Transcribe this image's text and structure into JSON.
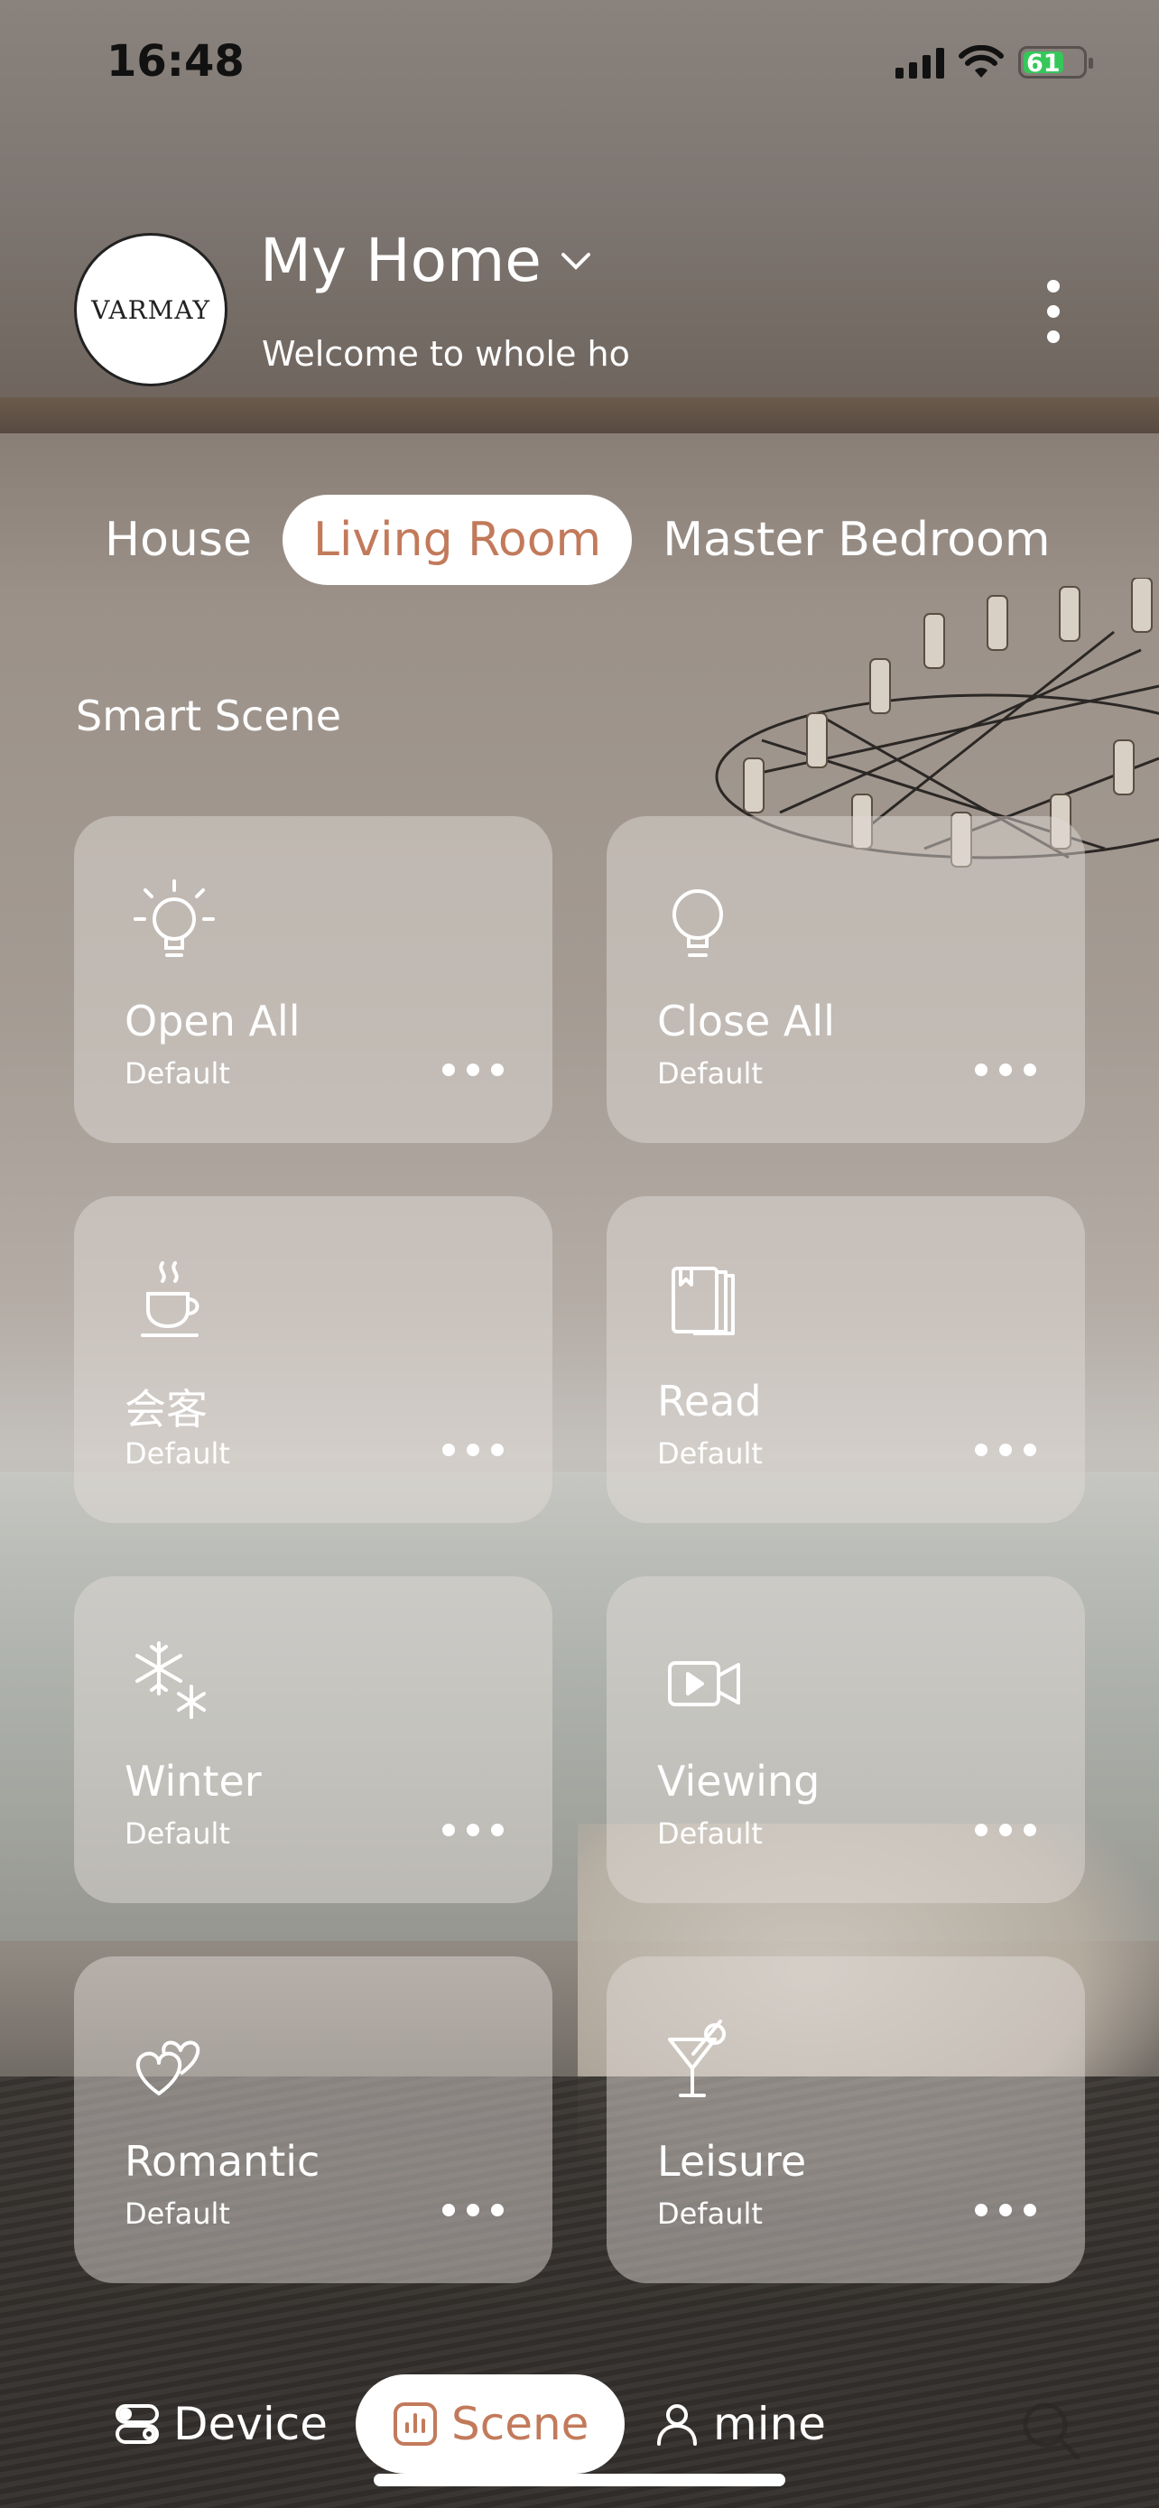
{
  "status_bar": {
    "time": "16:48",
    "battery": "61"
  },
  "header": {
    "logo_text": "VARMAY",
    "home_name": "My Home",
    "welcome": "Welcome to whole home"
  },
  "room_tabs": [
    {
      "label": "House",
      "active": false
    },
    {
      "label": "Living Room",
      "active": true
    },
    {
      "label": "Master Bedroom",
      "active": false
    }
  ],
  "section_title": "Smart Scene",
  "scenes": [
    {
      "name": "Open All",
      "sub": "Default",
      "icon": "bulb-on-icon"
    },
    {
      "name": "Close All",
      "sub": "Default",
      "icon": "bulb-off-icon"
    },
    {
      "name": "会客",
      "sub": "Default",
      "icon": "coffee-cup-icon"
    },
    {
      "name": "Read",
      "sub": "Default",
      "icon": "book-icon"
    },
    {
      "name": "Winter",
      "sub": "Default",
      "icon": "snowflake-icon"
    },
    {
      "name": "Viewing",
      "sub": "Default",
      "icon": "video-camera-icon"
    },
    {
      "name": "Romantic",
      "sub": "Default",
      "icon": "hearts-icon"
    },
    {
      "name": "Leisure",
      "sub": "Default",
      "icon": "cocktail-icon"
    }
  ],
  "bottom_nav": {
    "device": "Device",
    "scene": "Scene",
    "mine": "mine"
  },
  "colors": {
    "accent": "#c27a5b",
    "battery": "#35c759"
  }
}
